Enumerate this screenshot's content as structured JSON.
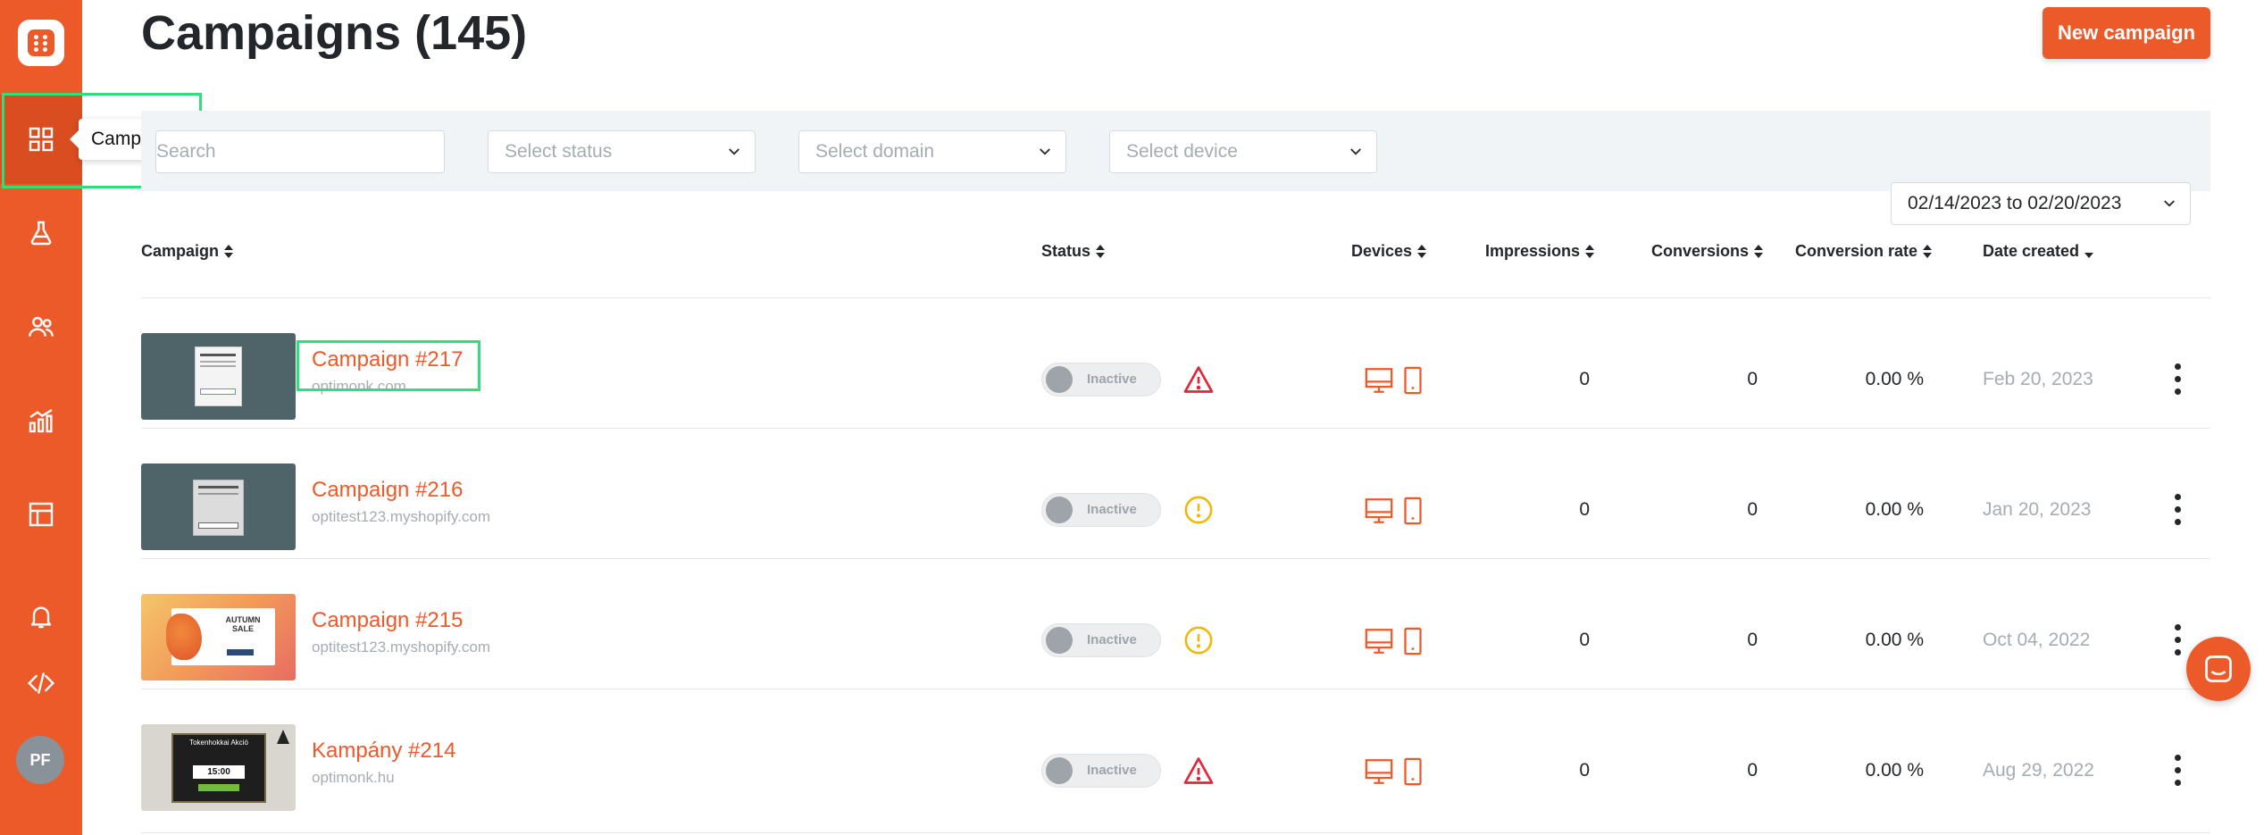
{
  "app": {
    "title": "Campaigns (145)",
    "new_campaign_label": "New campaign",
    "accent_color": "#ed5a29"
  },
  "sidebar": {
    "items": [
      {
        "name": "campaigns",
        "icon": "grid-icon"
      },
      {
        "name": "experiments",
        "icon": "flask-icon"
      },
      {
        "name": "users",
        "icon": "users-icon"
      },
      {
        "name": "analytics",
        "icon": "bar-chart-icon"
      },
      {
        "name": "templates",
        "icon": "layout-icon"
      },
      {
        "name": "notifications",
        "icon": "bell-icon"
      },
      {
        "name": "code",
        "icon": "code-icon"
      }
    ],
    "tooltip": "Campaigns",
    "avatar_initials": "PF"
  },
  "filters": {
    "search_placeholder": "Search",
    "status_placeholder": "Select status",
    "domain_placeholder": "Select domain",
    "device_placeholder": "Select device",
    "date_range": "02/14/2023 to 02/20/2023"
  },
  "table": {
    "columns": [
      "Campaign",
      "Status",
      "Devices",
      "Impressions",
      "Conversions",
      "Conversion rate",
      "Date created"
    ],
    "rows": [
      {
        "name": "Campaign #217",
        "domain": "optimonk.com",
        "status": "Inactive",
        "warning": "error",
        "impressions": "0",
        "conversions": "0",
        "rate": "0.00 %",
        "date": "Feb 20, 2023"
      },
      {
        "name": "Campaign #216",
        "domain": "optitest123.myshopify.com",
        "status": "Inactive",
        "warning": "caution",
        "impressions": "0",
        "conversions": "0",
        "rate": "0.00 %",
        "date": "Jan 20, 2023"
      },
      {
        "name": "Campaign #215",
        "domain": "optitest123.myshopify.com",
        "status": "Inactive",
        "warning": "caution",
        "impressions": "0",
        "conversions": "0",
        "rate": "0.00 %",
        "date": "Oct 04, 2022"
      },
      {
        "name": "Kampány #214",
        "domain": "optimonk.hu",
        "status": "Inactive",
        "warning": "error",
        "impressions": "0",
        "conversions": "0",
        "rate": "0.00 %",
        "date": "Aug 29, 2022"
      }
    ]
  },
  "thumbs": {
    "row3_title": "AUTUMN SALE",
    "row4_title": "Tokenhokkai Akció",
    "row4_time": "15:00"
  }
}
